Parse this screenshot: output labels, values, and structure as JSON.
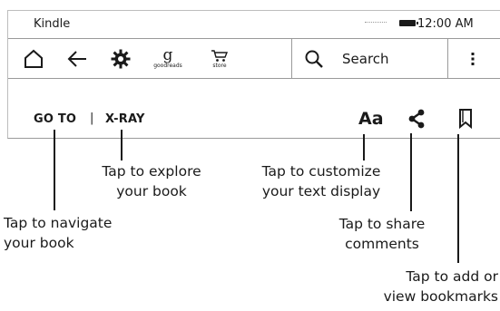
{
  "status_bar": {
    "app_name": "Kindle",
    "time": "12:00 AM",
    "battery_icon": "battery-icon",
    "wifi_icon": "wifi-dots-icon"
  },
  "toolbar": {
    "home_icon": "home-icon",
    "back_icon": "back-arrow-icon",
    "settings_icon": "gear-icon",
    "goodreads_glyph": "g",
    "goodreads_label": "goodreads",
    "store_label": "store",
    "store_icon": "cart-icon",
    "search_icon": "search-icon",
    "search_label": "Search",
    "menu_icon": "menu-icon"
  },
  "reading_bar": {
    "goto_label": "GO TO",
    "separator": "|",
    "xray_label": "X-RAY",
    "font_label": "Aa",
    "share_icon": "share-icon",
    "bookmark_icon": "bookmark-icon"
  },
  "callouts": {
    "navigate": {
      "line1": "Tap to navigate",
      "line2": "your book"
    },
    "explore": {
      "line1": "Tap to explore",
      "line2": "your book"
    },
    "customize": {
      "line1": "Tap to customize",
      "line2": "your text display"
    },
    "share": {
      "line1": "Tap to share",
      "line2": "comments"
    },
    "bookmarks": {
      "line1": "Tap to add or",
      "line2": "view bookmarks"
    }
  }
}
